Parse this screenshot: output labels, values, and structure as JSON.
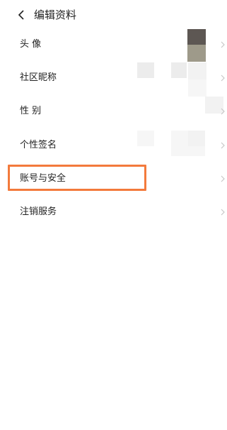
{
  "header": {
    "back_icon": "chevron-left-icon",
    "title": "编辑资料"
  },
  "rows": [
    {
      "label": "头 像",
      "icon": "chevron-right-icon"
    },
    {
      "label": "社区昵称",
      "icon": "chevron-right-icon"
    },
    {
      "label": "性 别",
      "icon": "chevron-right-icon"
    },
    {
      "label": "个性签名",
      "icon": "chevron-right-icon"
    },
    {
      "label": "账号与安全",
      "icon": "chevron-right-icon"
    },
    {
      "label": "注销服务",
      "icon": "chevron-right-icon"
    }
  ],
  "colors": {
    "highlight": "#f37a3c",
    "text": "#222222",
    "chevron": "#c8c8c8"
  }
}
